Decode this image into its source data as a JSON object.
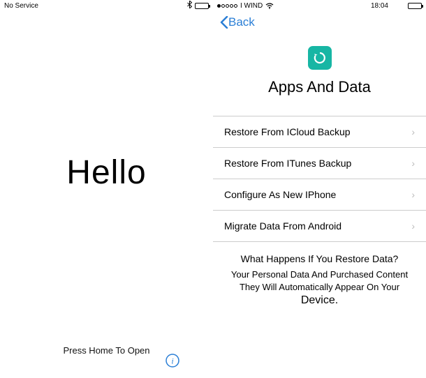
{
  "left": {
    "status": {
      "carrier": "No Service"
    },
    "hello": "Hello",
    "press_home": "Press Home To Open"
  },
  "right": {
    "status": {
      "carrier": "I WIND",
      "time": "18:04"
    },
    "back": "Back",
    "title": "Apps And Data",
    "options": [
      {
        "label": "Restore From ICloud Backup"
      },
      {
        "label": "Restore From ITunes Backup"
      },
      {
        "label": "Configure As New IPhone"
      },
      {
        "label": "Migrate Data From Android"
      }
    ],
    "info": {
      "heading": "What Happens If You Restore Data?",
      "line1": "Your Personal Data And Purchased Content",
      "line2": "They Will Automatically Appear On Your",
      "line3": "Device."
    }
  }
}
